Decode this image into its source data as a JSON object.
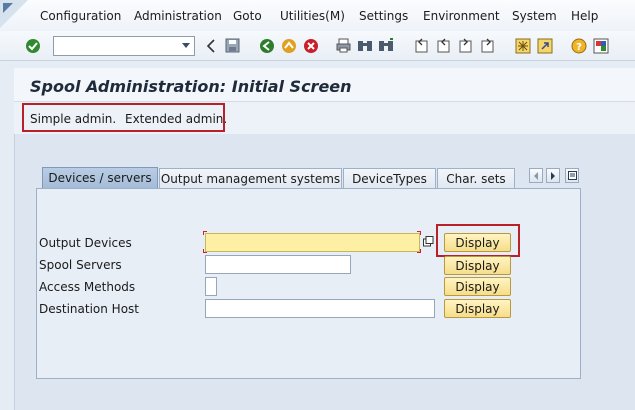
{
  "menu": {
    "items": [
      {
        "label": "Configuration"
      },
      {
        "label": "Administration"
      },
      {
        "label": "Goto"
      },
      {
        "label": "Utilities(M)"
      },
      {
        "label": "Settings"
      },
      {
        "label": "Environment"
      },
      {
        "label": "System"
      },
      {
        "label": "Help"
      }
    ]
  },
  "toolbar": {
    "command_field_value": "",
    "icons": [
      "enter-icon",
      "back-icon",
      "save-icon",
      "back-green-icon",
      "exit-icon",
      "cancel-icon",
      "print-icon",
      "find-icon",
      "find-next-icon",
      "first-page-icon",
      "previous-page-icon",
      "next-page-icon",
      "last-page-icon",
      "create-session-icon",
      "create-shortcut-icon",
      "help-icon",
      "layout-menu-icon"
    ]
  },
  "title": {
    "text": "Spool Administration: Initial Screen"
  },
  "app_toolbar": {
    "buttons": [
      {
        "label": "Simple admin."
      },
      {
        "label": "Extended admin."
      }
    ]
  },
  "tabs": [
    {
      "label": "Devices / servers",
      "active": true
    },
    {
      "label": "Output management systems",
      "active": false
    },
    {
      "label": "DeviceTypes",
      "active": false
    },
    {
      "label": "Char. sets",
      "active": false
    }
  ],
  "form": {
    "rows": [
      {
        "label": "Output Devices",
        "value": "",
        "button": "Display",
        "required": true
      },
      {
        "label": "Spool Servers",
        "value": "",
        "button": "Display",
        "required": false
      },
      {
        "label": "Access Methods",
        "value": "",
        "button": "Display",
        "required": false
      },
      {
        "label": "Destination Host",
        "value": "",
        "button": "Display",
        "required": false
      }
    ]
  },
  "colors": {
    "highlight_box": "#b8212a",
    "required_field": "#fdf0a4",
    "display_button": "#f6dd8a"
  }
}
